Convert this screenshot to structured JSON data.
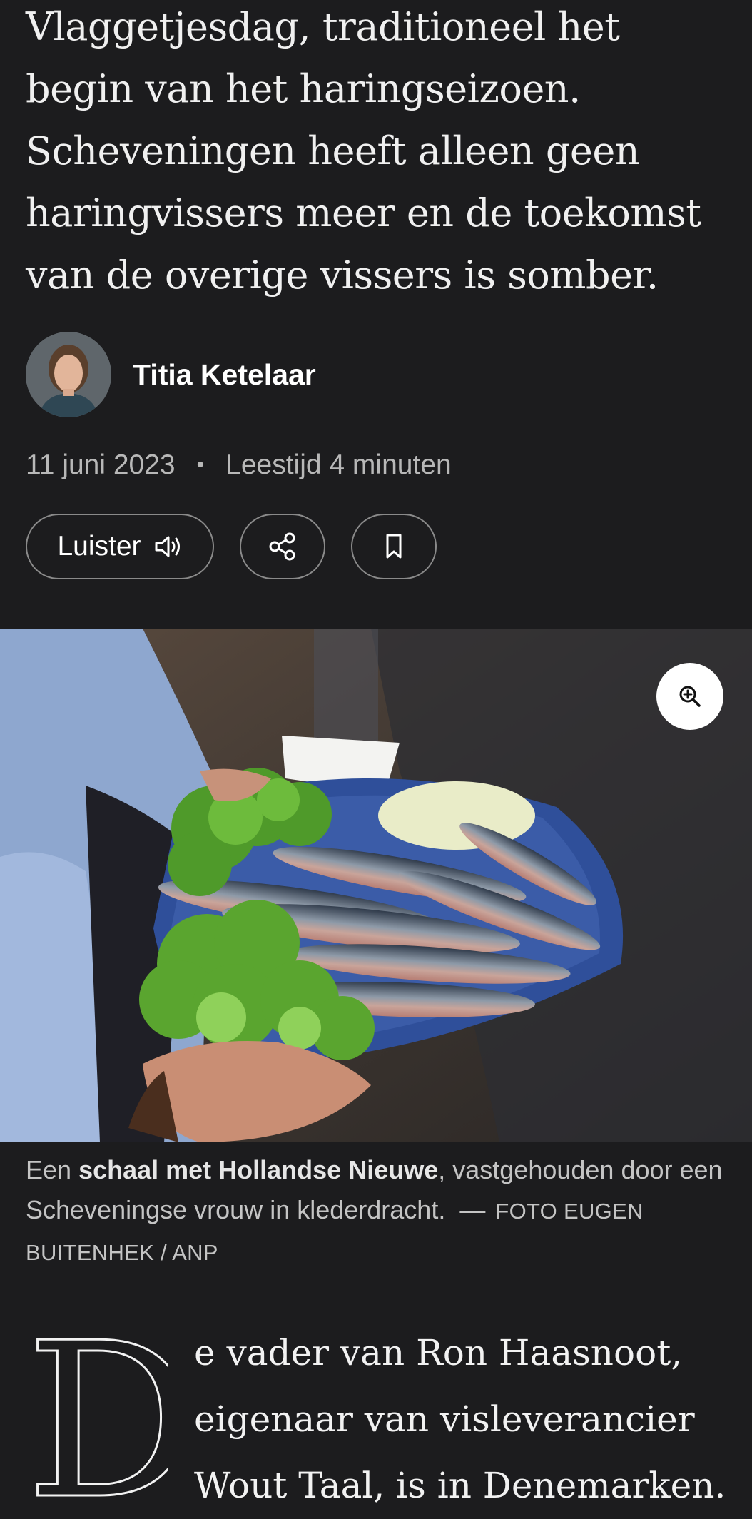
{
  "article": {
    "intro": "Vlaggetjesdag, traditioneel het begin van het haringseizoen. Scheveningen heeft alleen geen haringvissers meer en de toekomst van de overige vissers is somber.",
    "author": "Titia Ketelaar",
    "date": "11 juni 2023",
    "separator": "•",
    "reading_time": "Leestijd 4 minuten",
    "body_first_letter": "D",
    "body_opening": "e vader van Ron Haasnoot, eigenaar van visleverancier Wout Taal, is in Denemarken."
  },
  "actions": {
    "listen_label": "Luister",
    "listen_icon": "speaker-icon",
    "share_icon": "share-icon",
    "bookmark_icon": "bookmark-icon"
  },
  "photo": {
    "zoom_icon": "zoom-in-icon",
    "caption_before": "Een ",
    "caption_bold": "schaal met Hollandse Nieuwe",
    "caption_after": ", vastgehouden door een Scheveningse vrouw in klederdracht.",
    "caption_dash": "—",
    "credit": "FOTO EUGEN BUITENHEK / ANP"
  },
  "colors": {
    "background": "#1c1c1e",
    "text": "#ededed",
    "muted": "#b8b8b8"
  }
}
